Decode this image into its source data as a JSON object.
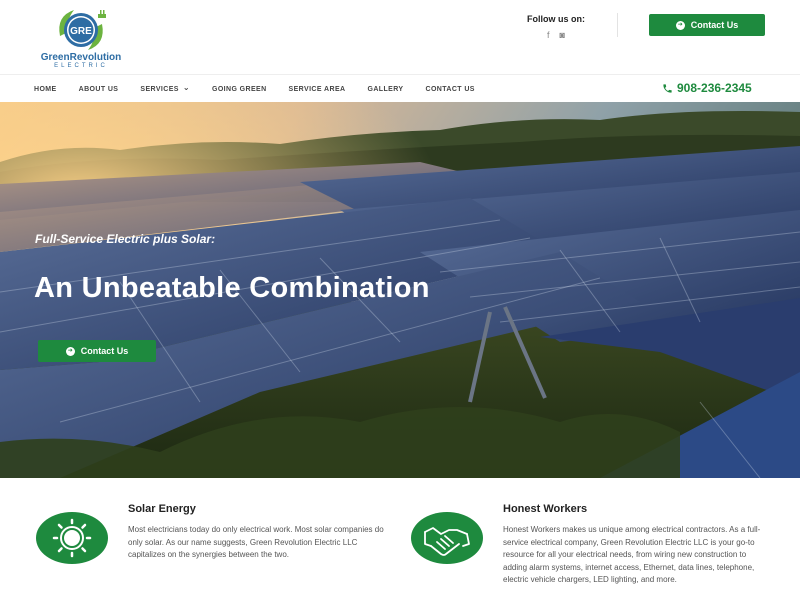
{
  "logo": {
    "initials": "GRE",
    "name": "GreenRevolution",
    "sub": "ELECTRIC"
  },
  "follow": {
    "label": "Follow us on:",
    "icons": [
      "facebook-icon",
      "instagram-icon"
    ],
    "facebook_glyph": "f",
    "instagram_glyph": "◙"
  },
  "header_cta": {
    "label": "Contact Us"
  },
  "nav": {
    "items": [
      {
        "label": "HOME"
      },
      {
        "label": "ABOUT US"
      },
      {
        "label": "SERVICES"
      },
      {
        "label": "GOING GREEN"
      },
      {
        "label": "SERVICE AREA"
      },
      {
        "label": "GALLERY"
      },
      {
        "label": "CONTACT US"
      }
    ],
    "services_chevron": "⌄",
    "phone": "908-236-2345"
  },
  "hero": {
    "subtitle": "Full-Service Electric plus Solar:",
    "title": "An Unbeatable Combination",
    "cta_label": "Contact Us"
  },
  "features": [
    {
      "title": "Solar Energy",
      "text": "Most electricians today do only electrical work. Most solar companies do only solar. As our name suggests, Green Revolution Electric LLC capitalizes on the synergies between the two."
    },
    {
      "title": "Honest Workers",
      "text": "Honest Workers makes us unique among electrical contractors. As a full-service electrical company, Green Revolution Electric LLC is your go-to resource for all your electrical needs, from wiring new construction to adding alarm systems, internet access, Ethernet, data lines, telephone, electric vehicle chargers, LED lighting, and more."
    }
  ],
  "colors": {
    "brand_green": "#1e8a3e",
    "logo_blue": "#2e6da4"
  }
}
